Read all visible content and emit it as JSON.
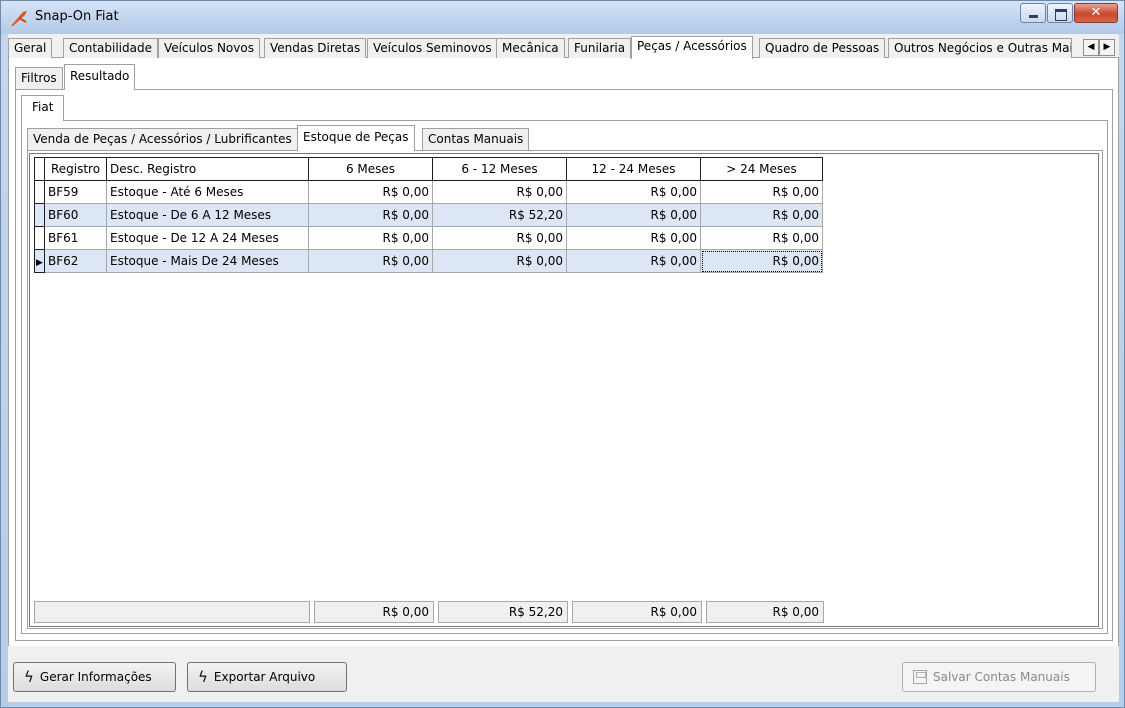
{
  "window": {
    "title": "Snap-On Fiat"
  },
  "main_tabs": [
    "Geral",
    "Contabilidade",
    "Veículos Novos",
    "Vendas Diretas",
    "Veículos Seminovos",
    "Mecânica",
    "Funilaria",
    "Peças / Acessórios",
    "Quadro de Pessoas",
    "Outros Negócios e Outras Mai"
  ],
  "active_main_tab": "Peças / Acessórios",
  "sub_tabs": [
    "Filtros",
    "Resultado"
  ],
  "brand_tab": "Fiat",
  "section_tabs": [
    "Venda de Peças / Acessórios / Lubrificantes",
    "Estoque de Peças",
    "Contas Manuais"
  ],
  "grid": {
    "headers": [
      "Registro",
      "Desc. Registro",
      "6 Meses",
      "6 - 12 Meses",
      "12 - 24 Meses",
      "> 24 Meses"
    ],
    "rows": [
      [
        "BF59",
        "Estoque - Até 6 Meses",
        "R$ 0,00",
        "R$ 0,00",
        "R$ 0,00",
        "R$ 0,00"
      ],
      [
        "BF60",
        "Estoque - De 6 A 12 Meses",
        "R$ 0,00",
        "R$ 52,20",
        "R$ 0,00",
        "R$ 0,00"
      ],
      [
        "BF61",
        "Estoque - De 12 A 24 Meses",
        "R$ 0,00",
        "R$ 0,00",
        "R$ 0,00",
        "R$ 0,00"
      ],
      [
        "BF62",
        "Estoque - Mais De 24 Meses",
        "R$ 0,00",
        "R$ 0,00",
        "R$ 0,00",
        "R$ 0,00"
      ]
    ],
    "totals": [
      "R$ 0,00",
      "R$ 52,20",
      "R$ 0,00",
      "R$ 0,00"
    ]
  },
  "buttons": {
    "gerar": "Gerar Informações",
    "exportar": "Exportar Arquivo",
    "salvar": "Salvar Contas Manuais"
  }
}
